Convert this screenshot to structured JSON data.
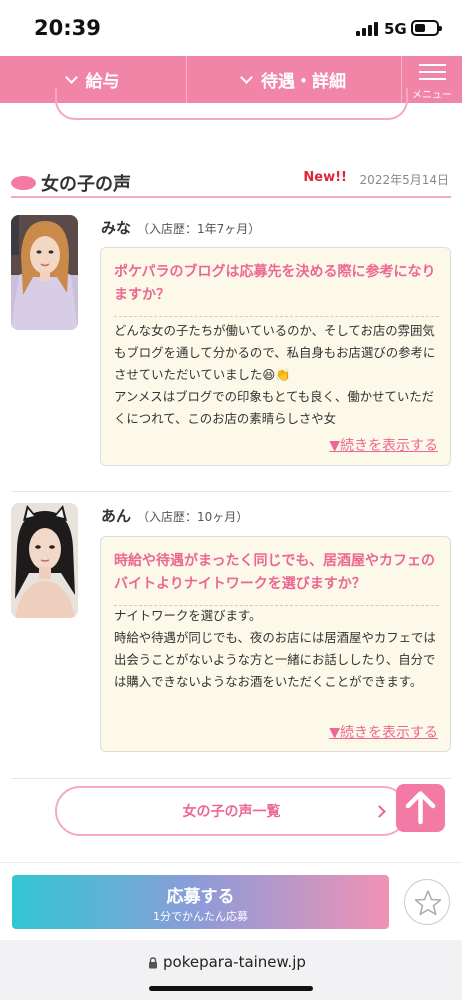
{
  "status_bar": {
    "time": "20:39",
    "network": "5G"
  },
  "nav": {
    "salary_label": "給与",
    "benefits_label": "待遇・詳細",
    "menu_label": "メニュー"
  },
  "section": {
    "title": "女の子の声",
    "new_badge": "New!!",
    "date": "2022年5月14日"
  },
  "voices": [
    {
      "name": "みな",
      "history": "（入店歴：1年7ヶ月）",
      "question": "ポケパラのブログは応募先を決める際に参考になりますか？",
      "answer": "どんな女の子たちが働いているのか、そしてお店の雰囲気もブログを通して分かるので、私自身もお店選びの参考にさせていただいていました😆👏\nアンメスはブログでの印象もとても良く、働かせていただくにつれて、このお店の素晴らしさや女",
      "more": "▼続きを表示する"
    },
    {
      "name": "あん",
      "history": "（入店歴：10ヶ月）",
      "question": "時給や待遇がまったく同じでも、居酒屋やカフェのバイトよりナイトワークを選びますか？",
      "answer": "ナイトワークを選びます。\n時給や待遇が同じでも、夜のお店には居酒屋やカフェでは出会うことがないような方と一緒にお話ししたり、自分では購入できないようなお酒をいただくことができます。",
      "more": "▼続きを表示する"
    }
  ],
  "list_button": "女の子の声一覧",
  "apply": {
    "main": "応募する",
    "sub": "1分でかんたん応募"
  },
  "url": "pokepara-tainew.jp",
  "colors": {
    "accent": "#f085a8",
    "pink_text": "#ec6793",
    "new": "#e0243a",
    "card_bg": "#fdf9e8"
  }
}
